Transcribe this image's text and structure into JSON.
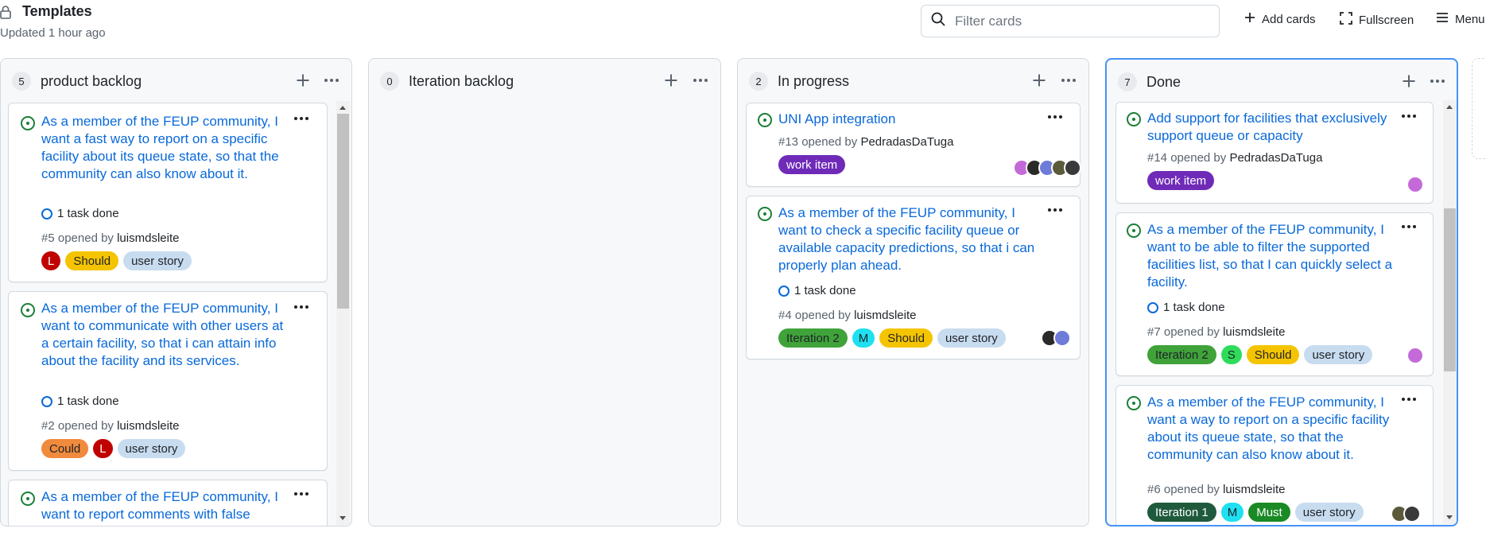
{
  "header": {
    "title": "Templates",
    "updated": "Updated 1 hour ago",
    "filter_placeholder": "Filter cards",
    "add_cards": "Add cards",
    "fullscreen": "Fullscreen",
    "menu": "Menu"
  },
  "columns": [
    {
      "count": "5",
      "title": "product backlog",
      "cards": [
        {
          "title": "As a member of the FEUP community, I want a fast way to report on a specific facility about its queue state, so that the community can also know about it.",
          "task": "1 task done",
          "number": "#5 opened by",
          "author": "luismdsleite",
          "labels": [
            "L",
            "Should",
            "user story"
          ]
        },
        {
          "title": "As a member of the FEUP community, I want to communicate with other users at a certain facility, so that i can attain info about the facility and its services.",
          "task": "1 task done",
          "number": "#2 opened by",
          "author": "luismdsleite",
          "labels": [
            "Could",
            "L",
            "user story"
          ]
        },
        {
          "title": "As a member of the FEUP community, I want to report comments with false"
        }
      ]
    },
    {
      "count": "0",
      "title": "Iteration backlog",
      "cards": []
    },
    {
      "count": "2",
      "title": "In progress",
      "cards": [
        {
          "title": "UNI App integration",
          "number": "#13 opened by",
          "author": "PedradasDaTuga",
          "labels": [
            "work item"
          ]
        },
        {
          "title": "As a member of the FEUP community, I want to check a specific facility queue or available capacity predictions, so that i can properly plan ahead.",
          "task": "1 task done",
          "number": "#4 opened by",
          "author": "luismdsleite",
          "labels": [
            "Iteration 2",
            "M",
            "Should",
            "user story"
          ]
        }
      ]
    },
    {
      "count": "7",
      "title": "Done",
      "cards": [
        {
          "title": "Add support for facilities that exclusively support queue or capacity",
          "number": "#14 opened by",
          "author": "PedradasDaTuga",
          "labels": [
            "work item"
          ]
        },
        {
          "title": "As a member of the FEUP community, I want to be able to filter the supported facilities list, so that I can quickly select a facility.",
          "task": "1 task done",
          "number": "#7 opened by",
          "author": "luismdsleite",
          "labels": [
            "Iteration 2",
            "S",
            "Should",
            "user story"
          ]
        },
        {
          "title": "As a member of the FEUP community, I want a way to report on a specific facility about its queue state, so that the community can also know about it.",
          "number": "#6 opened by",
          "author": "luismdsleite",
          "labels": [
            "Iteration 1",
            "M",
            "Must",
            "user story"
          ]
        }
      ]
    }
  ],
  "colors": {
    "link": "#0969da",
    "open_issue": "#1a7f37",
    "selected_column_border": "#4493f8",
    "label_L": "#c00000",
    "label_should": "#f5c400",
    "label_could": "#f08a3c",
    "label_must": "#1a8a25",
    "label_user_story": "#c8dcf0",
    "label_work_item": "#6f2bb8",
    "label_iteration_2": "#3fa33a",
    "label_iteration_1": "#1f5a3c",
    "label_M": "#1ee0f0",
    "label_S": "#2fdc5a"
  }
}
